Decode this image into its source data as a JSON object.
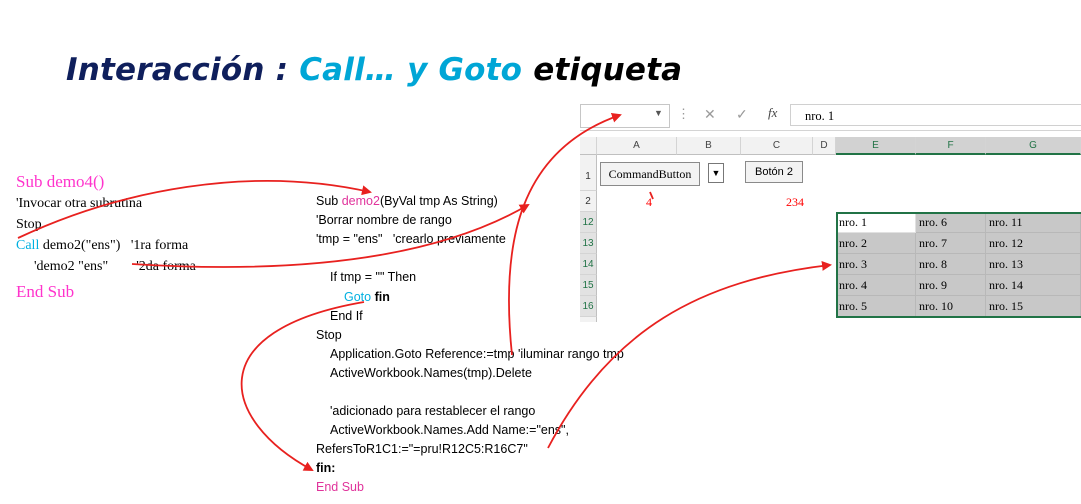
{
  "title": {
    "part1": "Interacción :",
    "part2": "Call… y Goto",
    "part3": "etiqueta"
  },
  "left_code": {
    "sub": "Sub demo4()",
    "comment1": "'Invocar otra subrutina",
    "stop": "Stop",
    "call_kw": "Call",
    "call_rest": " demo2(\"ens\")   '1ra forma",
    "alt": "'demo2 \"ens\"        '2da forma",
    "end": "End Sub"
  },
  "mid_code": {
    "sub_prefix": "Sub ",
    "sub_name": "demo2",
    "sub_suffix": "(ByVal tmp As String)",
    "c1": "'Borrar nombre de rango",
    "c2": "'tmp = \"ens\"   'crearlo previamente",
    "if_line": "If tmp = \"\" Then",
    "goto_kw": "Goto",
    "goto_label": "fin",
    "end_if": "End If",
    "stop": "Stop",
    "app_goto": "Application.Goto Reference:=tmp 'iluminar rango tmp",
    "delete": "ActiveWorkbook.Names(tmp).Delete",
    "c3": "'adicionado para restablecer el rango",
    "add": "ActiveWorkbook.Names.Add Name:=\"ens\",",
    "refers": "RefersToR1C1:=\"=pru!R12C5:R16C7\"",
    "label": "fin:",
    "end": "End Sub"
  },
  "excel": {
    "formula_bar": {
      "fx": "fx",
      "value": "nro. 1"
    },
    "columns": [
      "A",
      "B",
      "C",
      "D",
      "E",
      "F",
      "G"
    ],
    "rows": [
      "1",
      "2",
      "12",
      "13",
      "14",
      "15",
      "16"
    ],
    "button1": "CommandButton",
    "button2": "Botón 2",
    "b2_value": "4",
    "c2_value": "234",
    "table": [
      [
        "nro. 1",
        "nro. 6",
        "nro. 11"
      ],
      [
        "nro. 2",
        "nro. 7",
        "nro. 12"
      ],
      [
        "nro. 3",
        "nro. 8",
        "nro. 13"
      ],
      [
        "nro. 4",
        "nro. 9",
        "nro. 14"
      ],
      [
        "nro. 5",
        "nro. 10",
        "nro. 15"
      ]
    ]
  },
  "colors": {
    "arrow": "#e8211f",
    "title_dark": "#0f1f5c",
    "title_blue": "#00a6d6",
    "magenta": "#ff33cc",
    "excel_green": "#217346"
  }
}
